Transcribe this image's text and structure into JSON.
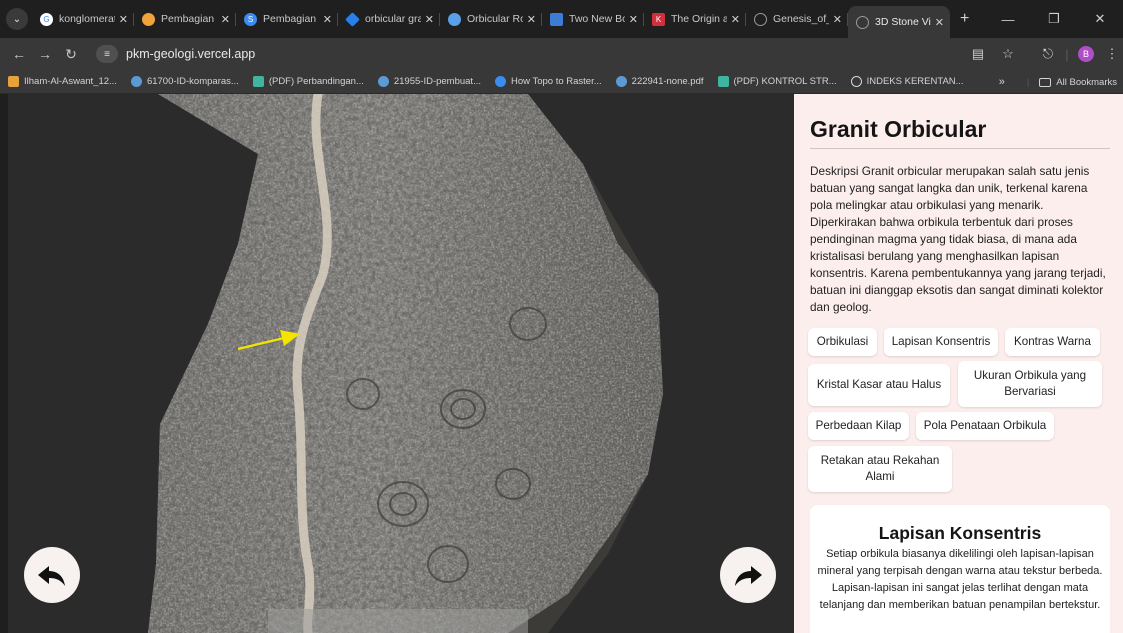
{
  "browser": {
    "tabs": [
      {
        "title": "konglomerat",
        "color": "#ffffff",
        "glyph": "G"
      },
      {
        "title": "Pembagian K",
        "color": "#f1a23a",
        "glyph": ""
      },
      {
        "title": "Pembagian K",
        "color": "#3c8cf0",
        "glyph": "S"
      },
      {
        "title": "orbicular gra",
        "color": "#2a7ee8",
        "glyph": ""
      },
      {
        "title": "Orbicular Roc",
        "color": "#5aa0e8",
        "glyph": ""
      },
      {
        "title": "Two New Bo",
        "color": "#3d7bd4",
        "glyph": ""
      },
      {
        "title": "The Origin ar",
        "color": "#d0303c",
        "glyph": "K"
      },
      {
        "title": "Genesis_of_o",
        "color": "#777777",
        "glyph": ""
      },
      {
        "title": "3D Stone Vie",
        "color": "#777777",
        "glyph": ""
      }
    ],
    "new_tab": "+",
    "url": "pkm-geologi.vercel.app",
    "profile_initial": "B",
    "bookmarks": [
      {
        "label": "Ilham-Al-Aswant_12...",
        "color": "#e8a23a"
      },
      {
        "label": "61700-ID-komparas...",
        "color": "#5b9bd5"
      },
      {
        "label": "(PDF) Perbandingan...",
        "color": "#3fb5a0"
      },
      {
        "label": "21955-ID-pembuat...",
        "color": "#5b9bd5"
      },
      {
        "label": "How Topo to Raster...",
        "color": "#3c8cf0"
      },
      {
        "label": "222941-none.pdf",
        "color": "#5b9bd5"
      },
      {
        "label": "(PDF) KONTROL STR...",
        "color": "#3fb5a0"
      },
      {
        "label": "INDEKS KERENTAN...",
        "color": "#d8d8d8"
      }
    ],
    "bookmarks_more": "»",
    "all_bookmarks": "All Bookmarks"
  },
  "panel": {
    "title": "Granit Orbicular",
    "description": "Deskripsi Granit orbicular merupakan salah satu jenis batuan yang sangat langka dan unik, terkenal karena pola melingkar atau orbikulasi yang menarik. Diperkirakan bahwa orbikula terbentuk dari proses pendinginan magma yang tidak biasa, di mana ada kristalisasi berulang yang menghasilkan lapisan konsentris. Karena pembentukannya yang jarang terjadi, batuan ini dianggap eksotis dan sangat diminati kolektor dan geolog.",
    "chips": [
      "Orbikulasi",
      "Lapisan Konsentris",
      "Kontras Warna",
      "Kristal Kasar atau Halus",
      "Ukuran Orbikula yang Bervariasi",
      "Perbedaan Kilap",
      "Pola Penataan Orbikula",
      "Retakan atau Rekahan Alami"
    ],
    "card": {
      "title": "Lapisan Konsentris",
      "text": "Setiap orbikula biasanya dikelilingi oleh lapisan-lapisan mineral yang terpisah dengan warna atau tekstur berbeda. Lapisan-lapisan ini sangat jelas terlihat dengan mata telanjang dan memberikan batuan penampilan bertekstur."
    }
  },
  "colors": {
    "annotation_arrow": "#f5e400",
    "panel_bg": "#fbeeec",
    "viewer_bg": "#2b2b2b"
  }
}
